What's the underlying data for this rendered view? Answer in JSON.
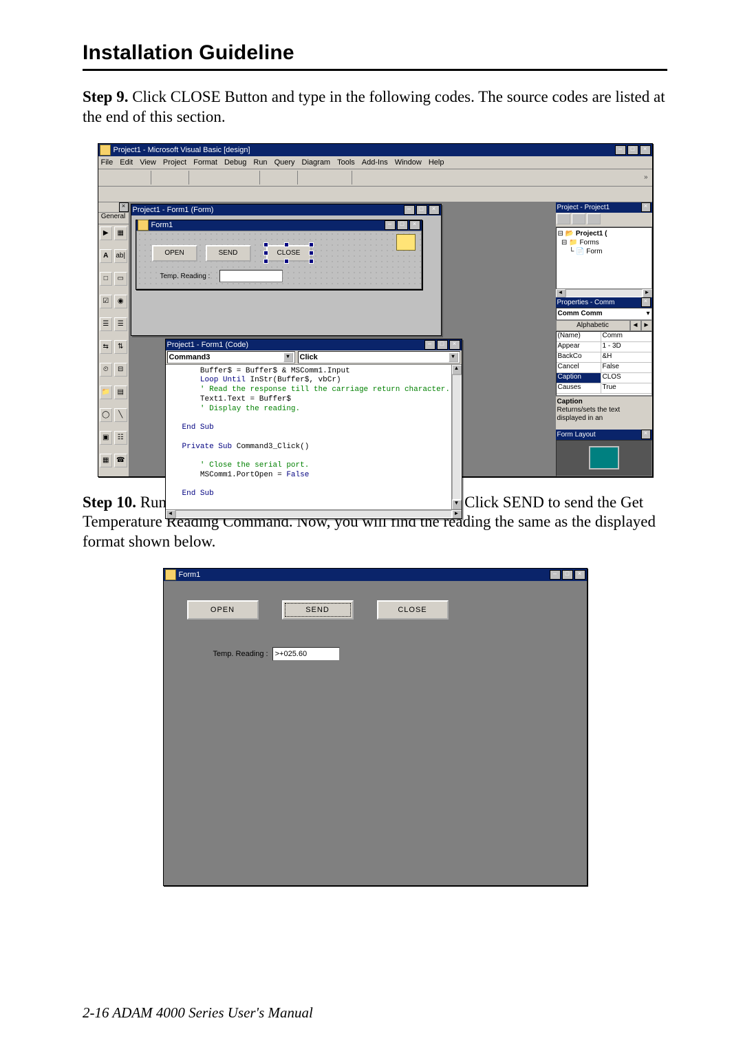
{
  "page": {
    "title": "Installation Guideline",
    "footer": "2-16 ADAM 4000 Series User's Manual"
  },
  "step9": {
    "label": "Step 9.",
    "text": " Click CLOSE Button and type in the following codes. The source codes are listed at the end of this section."
  },
  "step10": {
    "label": "Step 10.",
    "text": " Run the Project → Click OPEN to open COM1 → Click SEND to send the Get Temperature Reading Command. Now, you will find the reading the same as the displayed format shown below."
  },
  "ide": {
    "title": "Project1 - Microsoft Visual Basic [design]",
    "menus": [
      "File",
      "Edit",
      "View",
      "Project",
      "Format",
      "Debug",
      "Run",
      "Query",
      "Diagram",
      "Tools",
      "Add-Ins",
      "Window",
      "Help"
    ],
    "palette_tab": "General",
    "toolbox_tools": [
      "pointer",
      "picturebox",
      "label",
      "textbox",
      "frame",
      "command",
      "checkbox",
      "option",
      "combobox",
      "listbox",
      "hscroll",
      "vscroll",
      "timer",
      "drive",
      "dir",
      "file",
      "shape",
      "line",
      "image",
      "data",
      "ole",
      "mscomm"
    ],
    "designer_window_title": "Project1 - Form1 (Form)",
    "form1": {
      "title": "Form1",
      "open_btn": "OPEN",
      "send_btn": "SEND",
      "close_btn": "CLOSE",
      "temp_label": "Temp. Reading :"
    },
    "code_window_title": "Project1 - Form1 (Code)",
    "code": {
      "object_combo": "Command3",
      "event_combo": "Click",
      "code_text": "    Buffer$ = Buffer$ & MSComm1.Input\n    Loop Until InStr(Buffer$, vbCr)\n    ' Read the response till the carriage return character.\n    Text1.Text = Buffer$\n    ' Display the reading.\n\nEnd Sub\n\nPrivate Sub Command3_Click()\n\n    ' Close the serial port.\n    MSComm1.PortOpen = False\n\nEnd Sub"
    },
    "project_panel_title": "Project - Project1",
    "project_tree": {
      "root": "Project1 (",
      "folder": "Forms",
      "item": "Form"
    },
    "props_panel_title": "Properties - Comm",
    "props": {
      "combo": "Comm  Comm",
      "tab1": "Alphabetic",
      "rows": [
        {
          "k": "(Name)",
          "v": "Comm"
        },
        {
          "k": "Appear",
          "v": "1 - 3D"
        },
        {
          "k": "BackCo",
          "v": "&H"
        },
        {
          "k": "Cancel",
          "v": "False"
        },
        {
          "k": "Caption",
          "v": "CLOS"
        },
        {
          "k": "Causes",
          "v": "True"
        }
      ],
      "desc_title": "Caption",
      "desc_body": "Returns/sets the text displayed in an"
    },
    "formlayout_title": "Form Layout"
  },
  "run": {
    "title": "Form1",
    "open_btn": "OPEN",
    "send_btn": "SEND",
    "close_btn": "CLOSE",
    "temp_label": "Temp. Reading :",
    "temp_value": ">+025.60"
  },
  "glyphs": {
    "min": "‒",
    "max": "□",
    "close": "×",
    "rest": "❐",
    "left": "◄",
    "right": "►",
    "up": "▲",
    "down": "▼",
    "dd": "▾",
    "more": "»"
  }
}
